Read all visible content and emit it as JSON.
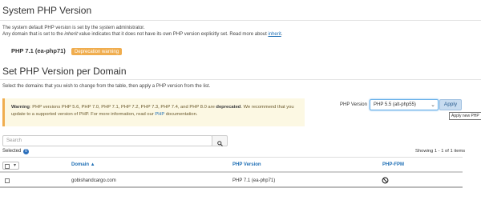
{
  "system_section": {
    "title": "System PHP Version",
    "desc_line1": "The system default PHP version is set by the system administrator.",
    "desc_line2_a": "Any domain that is set to the ",
    "desc_line2_italic": "inherit",
    "desc_line2_b": " value indicates that it does not have its own PHP version explicitly set. Read more about ",
    "desc_line2_link": "inherit",
    "desc_line2_end": ".",
    "current_version": "PHP 7.1 (ea-php71)",
    "deprecation_badge": "Deprecation warning"
  },
  "domain_section": {
    "title": "Set PHP Version per Domain",
    "description": "Select the domains that you wish to change from the table, then apply a PHP version from the list."
  },
  "warning": {
    "label": "Warning",
    "text_a": ": PHP versions PHP 5.6, PHP 7.0, PHP 7.1, PHP 7.2, PHP 7.3, PHP 7.4, and PHP 8.0 are ",
    "deprecated": "deprecated",
    "text_b": ". We recommend that you update to a supported version of PHP. For more information, read our ",
    "link": "PHP",
    "text_c": " documentation."
  },
  "controls": {
    "php_version_label": "PHP Version",
    "selected_version": "PHP 5.5 (alt-php55)",
    "apply_label": "Apply",
    "tooltip": "Apply new PHP"
  },
  "search": {
    "placeholder": "Search"
  },
  "selection": {
    "label": "Selected",
    "count": "0",
    "showing": "Showing 1 - 1 of 1 items"
  },
  "table": {
    "headers": {
      "domain": "Domain ▲",
      "php": "PHP Version",
      "fpm": "PHP-FPM"
    },
    "rows": [
      {
        "domain": "gobishandcargo.com",
        "php": "PHP 7.1 (ea-php71)"
      }
    ]
  },
  "colors": {
    "accent": "#1f6fb5",
    "warning": "#f0ad4e",
    "badge": "#2a6ebb"
  }
}
